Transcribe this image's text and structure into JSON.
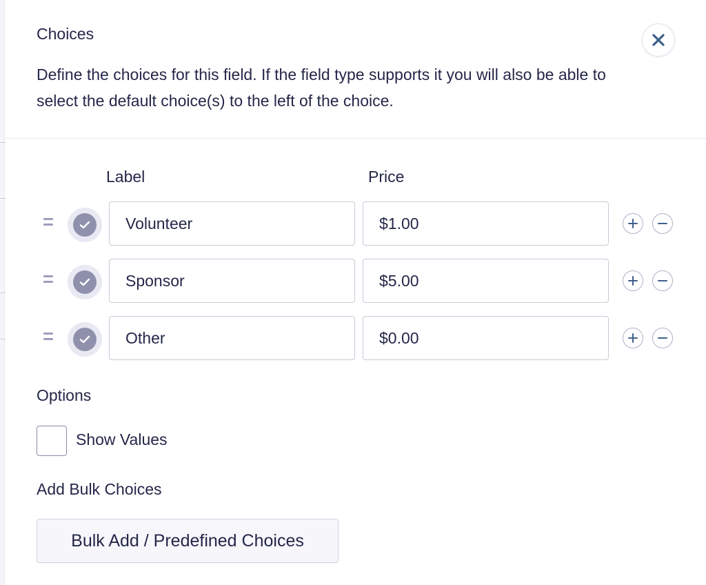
{
  "header": {
    "title": "Choices",
    "description": "Define the choices for this field. If the field type supports it you will also be able to select the default choice(s) to the left of the choice."
  },
  "columns": {
    "label": "Label",
    "price": "Price"
  },
  "choices": [
    {
      "label": "Volunteer",
      "price": "$1.00",
      "default": true
    },
    {
      "label": "Sponsor",
      "price": "$5.00",
      "default": true
    },
    {
      "label": "Other",
      "price": "$0.00",
      "default": true
    }
  ],
  "options": {
    "title": "Options",
    "show_values_label": "Show Values",
    "show_values_checked": false
  },
  "bulk": {
    "title": "Add Bulk Choices",
    "button_label": "Bulk Add / Predefined Choices"
  },
  "colors": {
    "text": "#242748",
    "toggle_fill": "#8f91ac",
    "toggle_ring": "#e9e9f3",
    "input_border": "#c8cbd9",
    "close_icon": "#3e5f8a"
  },
  "icons": {
    "close": "close-icon",
    "drag": "drag-handle-icon",
    "check": "check-icon",
    "add": "plus-icon",
    "remove": "minus-icon"
  }
}
